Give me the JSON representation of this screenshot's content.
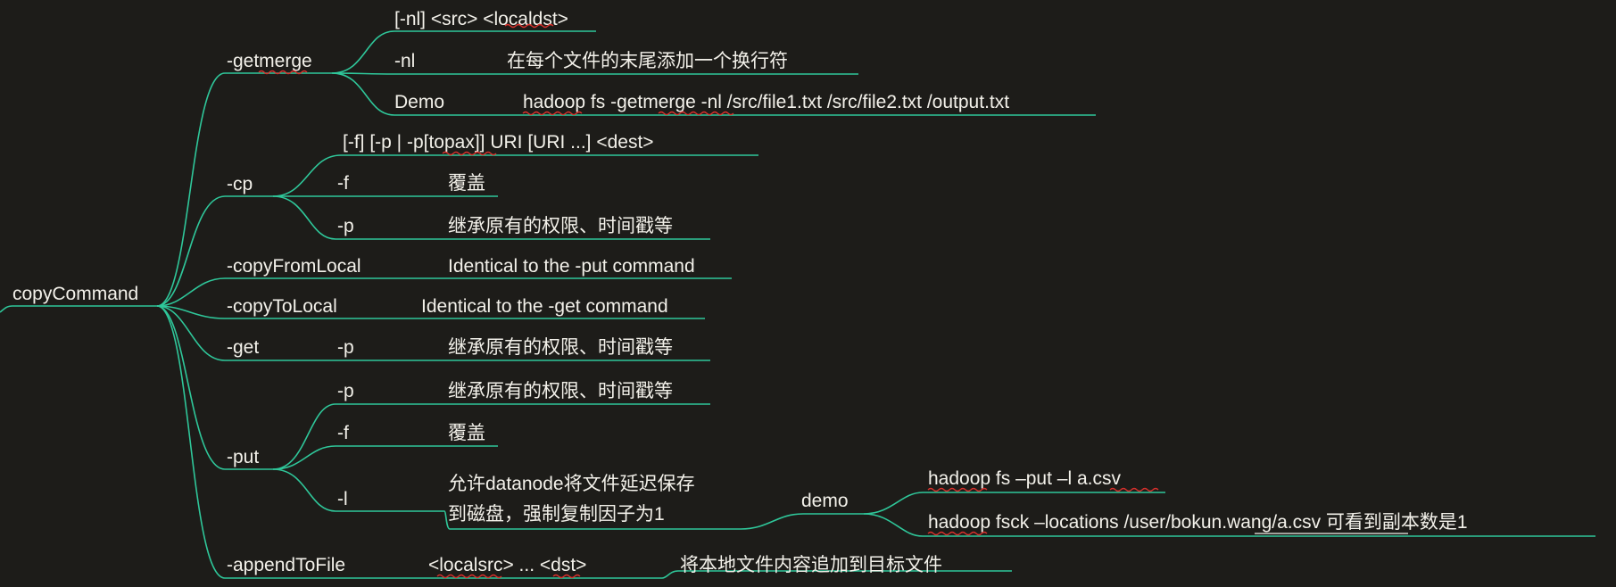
{
  "root": {
    "label": "copyCommand"
  },
  "branches": [
    {
      "id": "getmerge",
      "label": "-getmerge",
      "children": [
        {
          "label": "[-nl] <src> <localdst>"
        },
        {
          "label": "-nl",
          "desc": "在每个文件的末尾添加一个换行符"
        },
        {
          "label": "Demo",
          "desc": "hadoop fs -getmerge -nl /src/file1.txt /src/file2.txt /output.txt"
        }
      ]
    },
    {
      "id": "cp",
      "label": "-cp",
      "children": [
        {
          "label": "[-f] [-p | -p[topax]] URI [URI ...] <dest>"
        },
        {
          "label": "-f",
          "desc": "覆盖"
        },
        {
          "label": "-p",
          "desc": "继承原有的权限、时间戳等"
        }
      ]
    },
    {
      "id": "copyFromLocal",
      "label": "-copyFromLocal",
      "desc": "Identical to the -put command"
    },
    {
      "id": "copyToLocal",
      "label": "-copyToLocal",
      "desc": "Identical to the -get command"
    },
    {
      "id": "get",
      "label": "-get",
      "children": [
        {
          "label": "-p",
          "desc": "继承原有的权限、时间戳等"
        }
      ]
    },
    {
      "id": "put",
      "label": "-put",
      "children": [
        {
          "label": "-p",
          "desc": "继承原有的权限、时间戳等"
        },
        {
          "label": "-f",
          "desc": "覆盖"
        },
        {
          "label": "-l",
          "desc_lines": [
            "允许datanode将文件延迟保存",
            "到磁盘，强制复制因子为1"
          ],
          "sub": {
            "label": "demo",
            "items": [
              "hadoop fs –put –l a.csv",
              "hadoop fsck –locations  /user/bokun.wang/a.csv 可看到副本数是1"
            ]
          }
        }
      ]
    },
    {
      "id": "appendToFile",
      "label": "-appendToFile",
      "desc": "<localsrc> ... <dst>",
      "children": [
        {
          "label": "将本地文件内容追加到目标文件"
        }
      ]
    }
  ]
}
